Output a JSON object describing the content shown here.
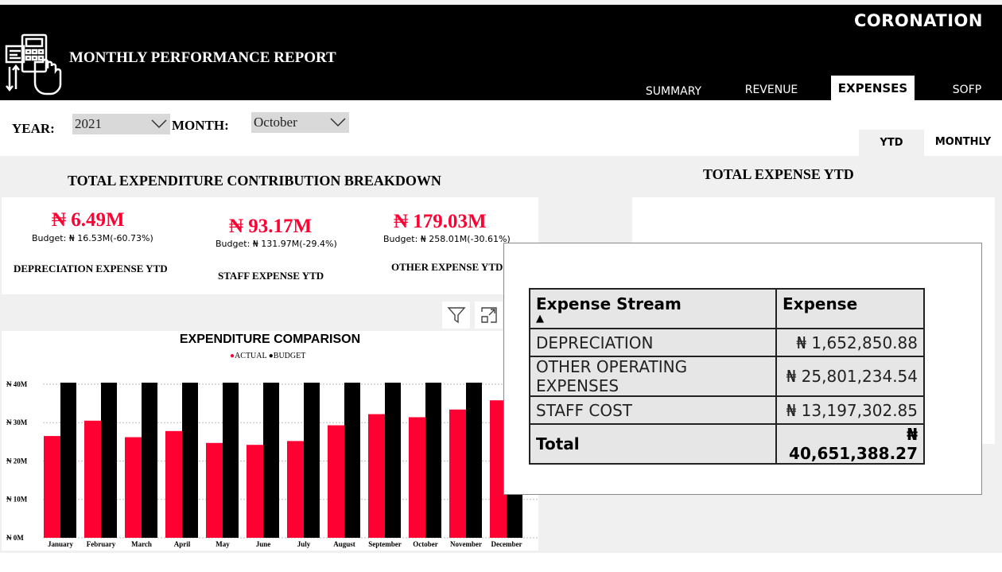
{
  "brand": "CORONATION",
  "report_title": "MONTHLY PERFORMANCE REPORT",
  "tabs": [
    {
      "label": "SUMMARY",
      "active": false
    },
    {
      "label": "REVENUE",
      "active": false
    },
    {
      "label": "EXPENSES",
      "active": true
    },
    {
      "label": "SOFP",
      "active": false
    }
  ],
  "filters": {
    "year_label": "YEAR:",
    "year_value": "2021",
    "month_label": "MONTH:",
    "month_value": "October"
  },
  "toggle": {
    "ytd": "YTD",
    "monthly": "MONTHLY"
  },
  "breakdown": {
    "title": "TOTAL EXPENDITURE CONTRIBUTION BREAKDOWN",
    "kpis": [
      {
        "value": "₦ 6.49M",
        "budget": "Budget: ₦ 16.53M(-60.73%)",
        "label": "DEPRECIATION EXPENSE YTD"
      },
      {
        "value": "₦ 93.17M",
        "budget": "Budget: ₦ 131.97M(-29.4%)",
        "label": "STAFF EXPENSE YTD"
      },
      {
        "value": "₦ 179.03M",
        "budget": "Budget: ₦ 258.01M(-30.61%)",
        "label": "OTHER EXPENSE YTD"
      }
    ]
  },
  "right_panel": {
    "title": "TOTAL EXPENSE YTD"
  },
  "colors": {
    "actual": "#ff0033",
    "budget": "#000000",
    "accent": "#ff0033"
  },
  "chart_data": {
    "type": "bar",
    "title": "EXPENDITURE COMPARISON",
    "legend": [
      "ACTUAL",
      "BUDGET"
    ],
    "legend_placement": "top-center",
    "categories": [
      "January",
      "February",
      "March",
      "April",
      "May",
      "June",
      "July",
      "August",
      "September",
      "October",
      "November",
      "December"
    ],
    "series": [
      {
        "name": "ACTUAL",
        "values": [
          26.5,
          30.5,
          26.2,
          27.8,
          24.7,
          24.2,
          25.2,
          29.3,
          32.2,
          31.4,
          33.4,
          35.8
        ]
      },
      {
        "name": "BUDGET",
        "values": [
          40.4,
          40.4,
          40.4,
          40.4,
          40.4,
          40.4,
          40.4,
          40.4,
          40.4,
          40.4,
          40.4,
          40.4
        ]
      }
    ],
    "y_ticks": [
      "₦ 0M",
      "₦ 10M",
      "₦ 20M",
      "₦ 30M",
      "₦ 40M"
    ],
    "ylim": [
      0,
      40.4
    ],
    "grid": true,
    "unit": "₦ M"
  },
  "table": {
    "headers": [
      "Expense Stream",
      "Expense"
    ],
    "sort_indicator": "▲",
    "rows": [
      [
        "DEPRECIATION",
        "₦ 1,652,850.88"
      ],
      [
        "OTHER OPERATING EXPENSES",
        "₦ 25,801,234.54"
      ],
      [
        "STAFF COST",
        "₦ 13,197,302.85"
      ]
    ],
    "total": [
      "Total",
      "₦ 40,651,388.27"
    ]
  },
  "icons": [
    "calculator-hand-icon",
    "chevron-down-icon",
    "filter-icon",
    "focus-mode-icon"
  ]
}
